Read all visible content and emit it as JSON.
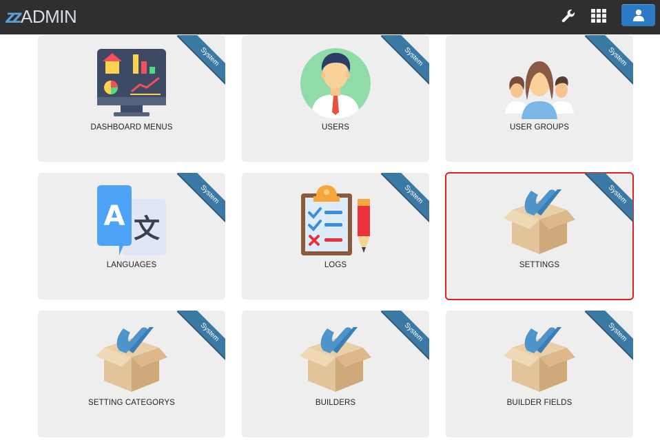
{
  "app": {
    "logo_mark": "zz",
    "logo_word": "ADMIN"
  },
  "toolbar": {
    "tools_icon": "wrench-icon",
    "apps_icon": "grid-icon",
    "user_icon": "user-icon"
  },
  "ribbon_text": "System",
  "colors": {
    "topbar": "#2f2f2f",
    "card_bg": "#eeeeee",
    "ribbon": "#3b79a5",
    "user_button": "#2d7ac4",
    "selection_outline": "#e02020"
  },
  "cards": [
    {
      "label": "DASHBOARD MENUS",
      "icon": "dashboard-monitor-icon",
      "ribbon": "System",
      "selected": false
    },
    {
      "label": "USERS",
      "icon": "user-avatar-icon",
      "ribbon": "System",
      "selected": false
    },
    {
      "label": "USER GROUPS",
      "icon": "user-group-icon",
      "ribbon": "System",
      "selected": false
    },
    {
      "label": "LANGUAGES",
      "icon": "translate-icon",
      "ribbon": "System",
      "selected": false
    },
    {
      "label": "LOGS",
      "icon": "clipboard-checklist-icon",
      "ribbon": "System",
      "selected": false
    },
    {
      "label": "SETTINGS",
      "icon": "package-box-icon",
      "ribbon": "System",
      "selected": true
    },
    {
      "label": "SETTING CATEGORYS",
      "icon": "package-box-icon",
      "ribbon": "System",
      "selected": false
    },
    {
      "label": "BUILDERS",
      "icon": "package-box-icon",
      "ribbon": "System",
      "selected": false
    },
    {
      "label": "BUILDER FIELDS",
      "icon": "package-box-icon",
      "ribbon": "System",
      "selected": false
    }
  ]
}
